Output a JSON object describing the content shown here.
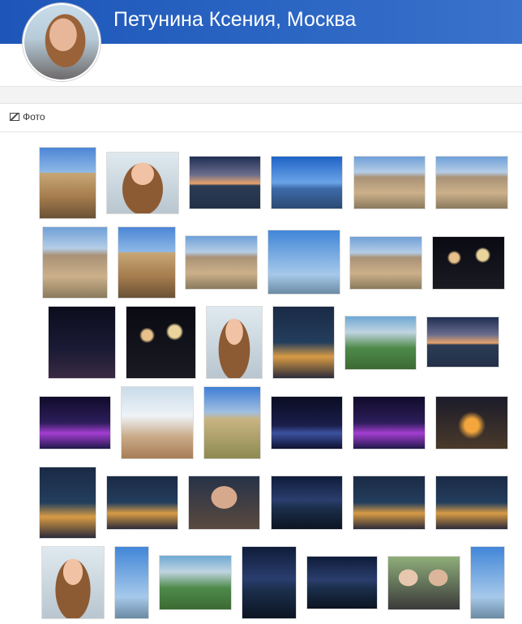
{
  "profile": {
    "title": "Петунина Ксения, Москва",
    "avatar_alt": "Петунина Ксения"
  },
  "section": {
    "icon": "photo-icon",
    "label": "Фото"
  },
  "colors": {
    "header": "#2d67c4",
    "title_text": "#ffffff",
    "gap_bar": "#f3f3f3",
    "divider": "#e3e3e3"
  }
}
